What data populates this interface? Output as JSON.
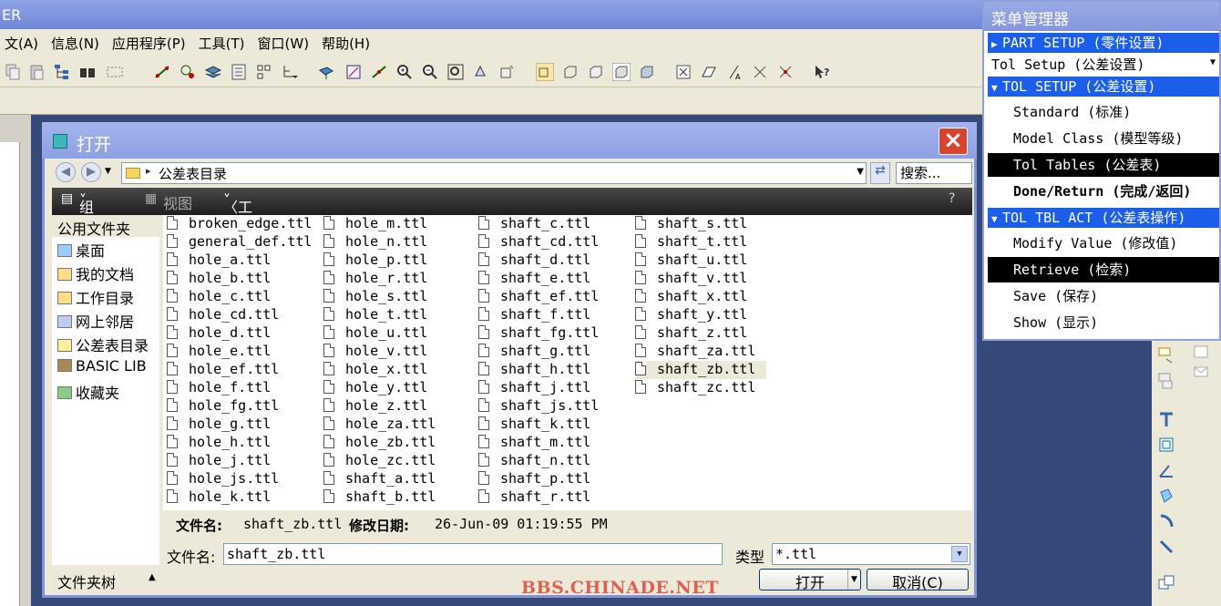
{
  "window": {
    "title_fragment": "ER"
  },
  "menubar": [
    "文(A)",
    "信息(N)",
    "应用程序(P)",
    "工具(T)",
    "窗口(W)",
    "帮助(H)"
  ],
  "dialog": {
    "title": "打开",
    "close_label": "×",
    "address": "公差表目录",
    "search_placeholder": "搜索...",
    "commands": {
      "organize": "组织",
      "view": "视图",
      "tools": "〈工具〉工具"
    },
    "nav_header": "公用文件夹",
    "nav_items": [
      "桌面",
      "我的文档",
      "工作目录",
      "网上邻居",
      "公差表目录",
      "BASIC LIB",
      "收藏夹"
    ],
    "files": [
      [
        "broken_edge.ttl",
        "general_def.ttl",
        "hole_a.ttl",
        "hole_b.ttl",
        "hole_c.ttl",
        "hole_cd.ttl",
        "hole_d.ttl",
        "hole_e.ttl",
        "hole_ef.ttl",
        "hole_f.ttl",
        "hole_fg.ttl",
        "hole_g.ttl",
        "hole_h.ttl",
        "hole_j.ttl",
        "hole_js.ttl",
        "hole_k.ttl"
      ],
      [
        "hole_m.ttl",
        "hole_n.ttl",
        "hole_p.ttl",
        "hole_r.ttl",
        "hole_s.ttl",
        "hole_t.ttl",
        "hole_u.ttl",
        "hole_v.ttl",
        "hole_x.ttl",
        "hole_y.ttl",
        "hole_z.ttl",
        "hole_za.ttl",
        "hole_zb.ttl",
        "hole_zc.ttl",
        "shaft_a.ttl",
        "shaft_b.ttl"
      ],
      [
        "shaft_c.ttl",
        "shaft_cd.ttl",
        "shaft_d.ttl",
        "shaft_e.ttl",
        "shaft_ef.ttl",
        "shaft_f.ttl",
        "shaft_fg.ttl",
        "shaft_g.ttl",
        "shaft_h.ttl",
        "shaft_j.ttl",
        "shaft_js.ttl",
        "shaft_k.ttl",
        "shaft_m.ttl",
        "shaft_n.ttl",
        "shaft_p.ttl",
        "shaft_r.ttl"
      ],
      [
        "shaft_s.ttl",
        "shaft_t.ttl",
        "shaft_u.ttl",
        "shaft_v.ttl",
        "shaft_x.ttl",
        "shaft_y.ttl",
        "shaft_z.ttl",
        "shaft_za.ttl",
        "shaft_zb.ttl",
        "shaft_zc.ttl"
      ]
    ],
    "selected_file": "shaft_zb.ttl",
    "detail": {
      "name_label": "文件名:",
      "name": "shaft_zb.ttl",
      "date_label": "修改日期:",
      "date": "26-Jun-09 01:19:55 PM"
    },
    "filename_label": "文件名:",
    "filename_value": "shaft_zb.ttl",
    "type_label": "类型",
    "type_value": "*.ttl",
    "folder_tree_label": "文件夹树",
    "open_label": "打开",
    "cancel_label": "取消(C)"
  },
  "watermark": "BBS.CHINADE.NET",
  "menu_manager": {
    "title": "菜单管理器",
    "part_setup": "PART SETUP (零件设置)",
    "tol_setup_select": "Tol Setup (公差设置)",
    "tol_setup_header": "TOL SETUP (公差设置)",
    "standard": "Standard (标准)",
    "model_class": "Model Class (模型等级)",
    "tol_tables": "Tol Tables (公差表)",
    "done_return": "Done/Return (完成/返回)",
    "tol_tbl_act": "TOL TBL ACT (公差表操作)",
    "modify_value": "Modify Value (修改值)",
    "retrieve": "Retrieve (检索)",
    "save": "Save (保存)",
    "show": "Show (显示)"
  }
}
